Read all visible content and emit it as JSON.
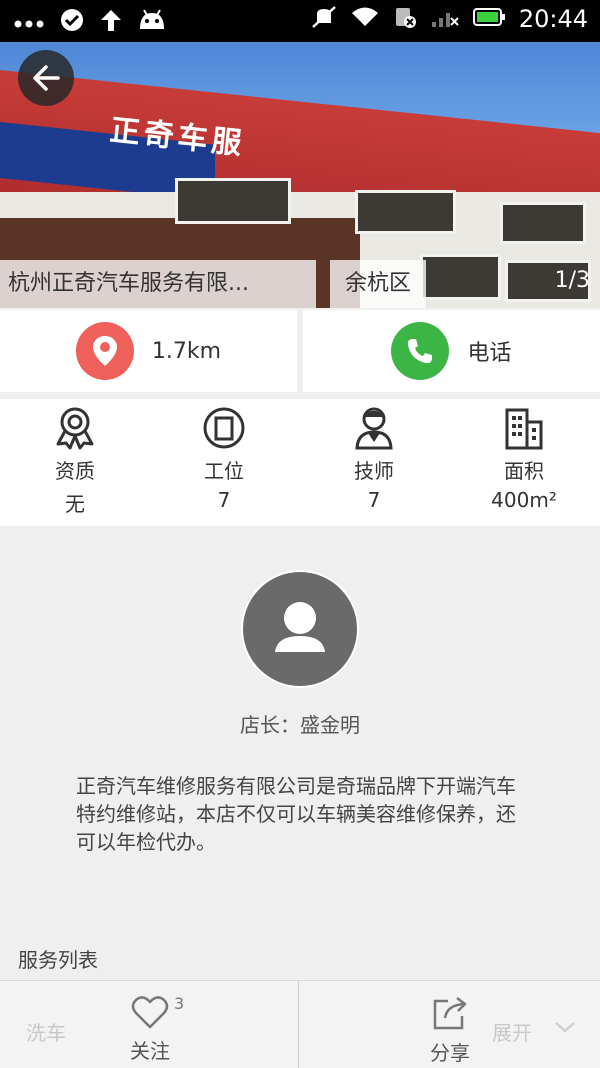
{
  "status_bar": {
    "time": "20:44",
    "left_icons": [
      "more-icon",
      "check-circle-icon",
      "upload-arrow-icon",
      "android-icon"
    ],
    "right_icons": [
      "mute-icon",
      "wifi-icon",
      "sim-icon",
      "signal-icon",
      "battery-icon"
    ]
  },
  "hero": {
    "title": "杭州正奇汽车服务有限...",
    "district": "余杭区",
    "counter": "1/3",
    "sign_text": "正奇车服"
  },
  "actions": {
    "distance": "1.7km",
    "phone": "电话",
    "location_color": "#f0605a",
    "phone_color": "#3cb546"
  },
  "stats": [
    {
      "label": "资质",
      "value": "无",
      "icon": "badge-icon"
    },
    {
      "label": "工位",
      "value": "7",
      "icon": "workstation-icon"
    },
    {
      "label": "技师",
      "value": "7",
      "icon": "technician-icon"
    },
    {
      "label": "面积",
      "value": "400m²",
      "icon": "building-icon"
    }
  ],
  "owner": {
    "label": "店长：盛金明"
  },
  "description": "正奇汽车维修服务有限公司是奇瑞品牌下开端汽车特约维修站，本店不仅可以车辆美容维修保养，还可以年检代办。",
  "services": {
    "title": "服务列表",
    "first_item": "洗车",
    "expand": "展开"
  },
  "bottom_bar": {
    "follow_label": "关注",
    "follow_count": "3",
    "share_label": "分享"
  }
}
